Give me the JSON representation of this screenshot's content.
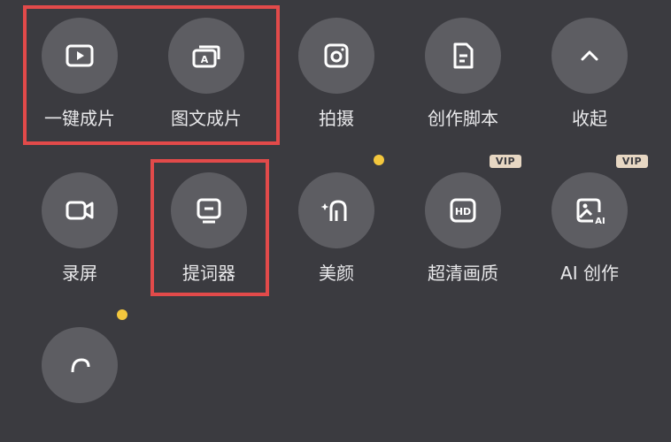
{
  "tools": [
    {
      "id": "one-click-video",
      "label": "一键成片",
      "icon": "play-icon"
    },
    {
      "id": "image-text-video",
      "label": "图文成片",
      "icon": "image-text-icon"
    },
    {
      "id": "shoot",
      "label": "拍摄",
      "icon": "camera-icon"
    },
    {
      "id": "script",
      "label": "创作脚本",
      "icon": "document-icon"
    },
    {
      "id": "collapse",
      "label": "收起",
      "icon": "chevron-up-icon"
    },
    {
      "id": "record-screen",
      "label": "录屏",
      "icon": "video-camera-icon"
    },
    {
      "id": "teleprompter",
      "label": "提词器",
      "icon": "teleprompter-icon"
    },
    {
      "id": "beauty",
      "label": "美颜",
      "icon": "beauty-icon",
      "new_dot": true
    },
    {
      "id": "hd-quality",
      "label": "超清画质",
      "icon": "hd-icon",
      "badge": "VIP"
    },
    {
      "id": "ai-create",
      "label": "AI 创作",
      "icon": "ai-image-icon",
      "badge": "VIP"
    }
  ],
  "colors": {
    "background": "#3b3b40",
    "circle": "#5d5d62",
    "highlight": "#e24a4a",
    "dot": "#f3c73d",
    "vip_badge": "#e7d7c3"
  }
}
